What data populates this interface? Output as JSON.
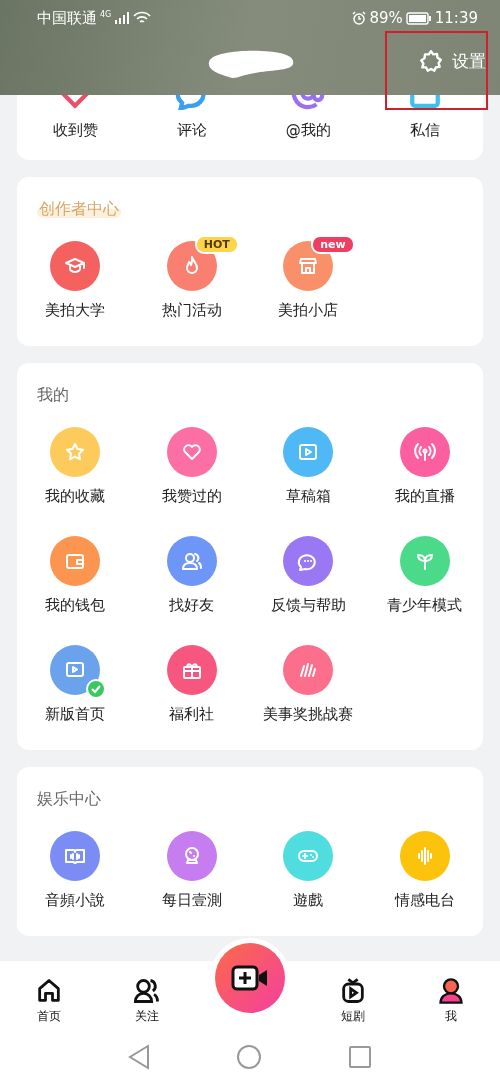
{
  "status_bar": {
    "carrier": "中国联通",
    "network_type": "4G",
    "battery": "89%",
    "time": "11:39"
  },
  "header": {
    "settings": "设置",
    "highlighted": true
  },
  "messages": [
    {
      "label": "收到赞",
      "color": "#e8506a"
    },
    {
      "label": "评论",
      "color": "#3aa0ee"
    },
    {
      "label": "@我的",
      "color": "#9a6ff0"
    },
    {
      "label": "私信",
      "color": "#3fc0e8"
    }
  ],
  "sections": [
    {
      "title": "创作者中心",
      "kind": "highlighted",
      "items": [
        {
          "label": "美拍大学",
          "color": "#f5615f",
          "verified": false
        },
        {
          "label": "热门活动",
          "color": "#f98070",
          "verified": false,
          "badge": {
            "text": "HOT",
            "color": "#fcd54a"
          }
        },
        {
          "label": "美拍小店",
          "color": "#f9906a",
          "verified": false,
          "badge": {
            "text": "new",
            "color": "#ee3e62"
          }
        }
      ]
    },
    {
      "title": "我的",
      "kind": "plain",
      "items": [
        {
          "label": "我的收藏",
          "color": "#fdcb5c",
          "verified": false
        },
        {
          "label": "我赞过的",
          "color": "#fb6fa4",
          "verified": false
        },
        {
          "label": "草稿箱",
          "color": "#4fb9f6",
          "verified": false
        },
        {
          "label": "我的直播",
          "color": "#fb5fa0",
          "verified": false
        },
        {
          "label": "我的钱包",
          "color": "#fb9550",
          "verified": false
        },
        {
          "label": "找好友",
          "color": "#6d96f6",
          "verified": false
        },
        {
          "label": "反馈与帮助",
          "color": "#9a78f4",
          "verified": false
        },
        {
          "label": "青少年模式",
          "color": "#4bd98a",
          "verified": false
        },
        {
          "label": "新版首页",
          "color": "#6aa2ec",
          "verified": true
        },
        {
          "label": "福利社",
          "color": "#f7577e",
          "verified": false
        },
        {
          "label": "美事奖挑战赛",
          "color": "#fb6f8d",
          "verified": false
        }
      ]
    },
    {
      "title": "娱乐中心",
      "kind": "plain",
      "items": [
        {
          "label": "音頻小說",
          "color": "#7b8df5",
          "verified": false
        },
        {
          "label": "每日壹測",
          "color": "#c57df0",
          "verified": false
        },
        {
          "label": "遊戲",
          "color": "#4fdde0",
          "verified": false
        },
        {
          "label": "情感电台",
          "color": "#fbc30c",
          "verified": false
        }
      ]
    }
  ],
  "tabs": [
    {
      "label": "首页",
      "selected": false
    },
    {
      "label": "关注",
      "selected": false
    },
    {
      "label": "短剧",
      "selected": false
    },
    {
      "label": "我",
      "selected": true
    }
  ]
}
